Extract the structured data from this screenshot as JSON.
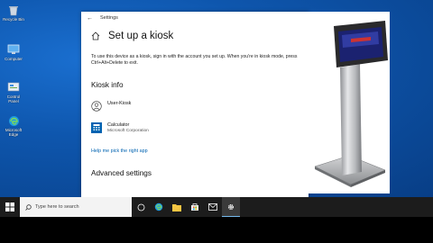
{
  "desktop": {
    "icons": [
      {
        "label": "Recycle Bin",
        "icon": "recycle-bin-icon"
      },
      {
        "label": "Computer",
        "icon": "computer-icon"
      },
      {
        "label": "Control Panel",
        "icon": "control-panel-icon"
      },
      {
        "label": "Microsoft Edge",
        "icon": "edge-icon"
      }
    ]
  },
  "window": {
    "title": "Settings",
    "page_title": "Set up a kiosk",
    "description": "To use this device as a kiosk, sign in with the account you set up. When you're in kiosk mode, press Ctrl+Alt+Delete to exit.",
    "kiosk_info_heading": "Kiosk info",
    "account_name": "User-Kiosk",
    "app_name": "Calculator",
    "app_publisher": "Microsoft Corporation",
    "help_link": "Help me pick the right app",
    "advanced_heading": "Advanced settings"
  },
  "taskbar": {
    "search_placeholder": "Type here to search",
    "icons": [
      "task-view-icon",
      "edge-icon",
      "file-explorer-icon",
      "store-icon",
      "mail-icon",
      "settings-icon"
    ]
  },
  "colors": {
    "accent": "#0063b1",
    "taskbar": "#1c1c1c",
    "wallpaper": "#0e56ad"
  }
}
